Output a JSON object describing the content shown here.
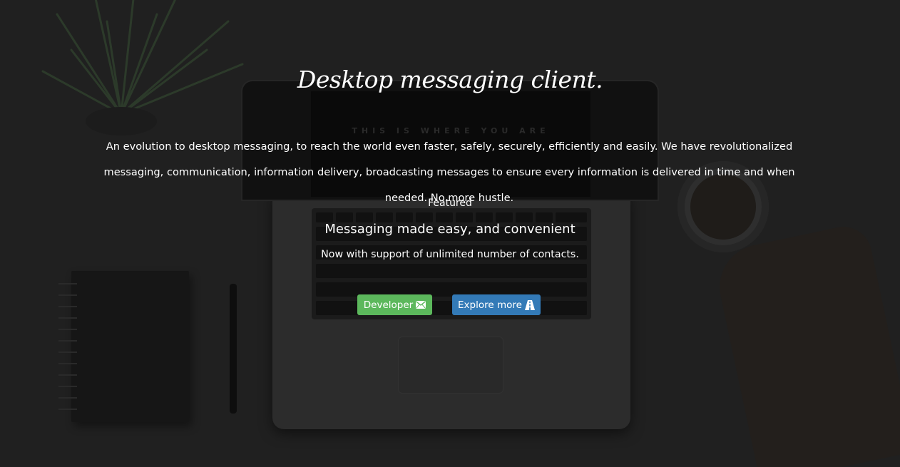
{
  "hero": {
    "title": "Desktop messaging client.",
    "description": "An evolution to desktop messaging, to reach the world even faster, safely, securely, efficiently and easily. We have revolutionalized messaging, communication, information delivery, broadcasting messages to ensure every information is delivered in time and when needed. No more hustle.",
    "featured_label": "Featured",
    "headline": "Messaging made easy, and convenient",
    "subline": "Now with support of unlimited number of contacts."
  },
  "buttons": {
    "developer": {
      "label": "Developer",
      "icon": "envelope-icon",
      "color": "#5cb85c"
    },
    "explore": {
      "label": "Explore more",
      "icon": "road-icon",
      "color": "#337ab7"
    }
  },
  "background": {
    "screen_text": "THIS IS WHERE YOU ARE",
    "overlay_color": "#000000"
  }
}
